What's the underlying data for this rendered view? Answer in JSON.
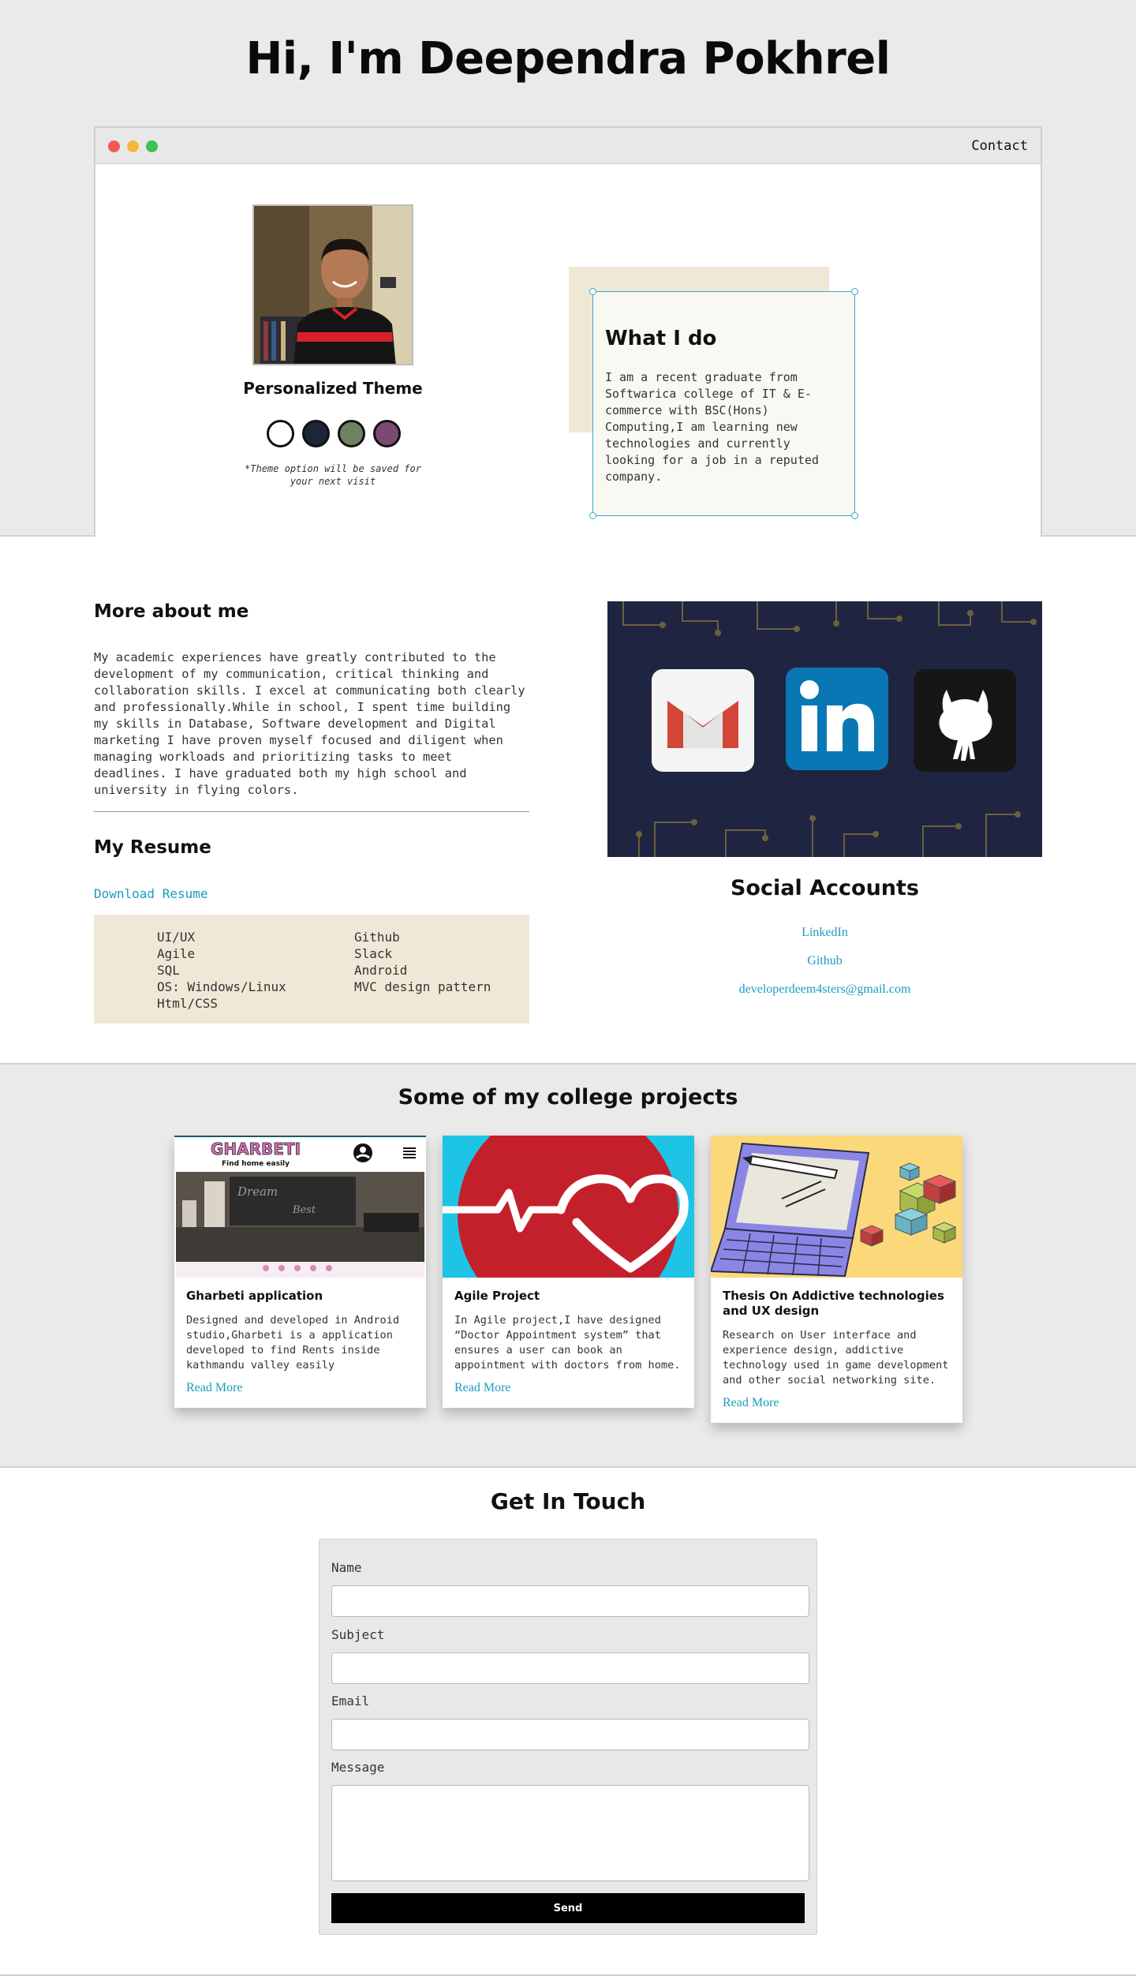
{
  "hero": {
    "title": "Hi, I'm Deependra Pokhrel",
    "contact_link": "Contact"
  },
  "theme": {
    "title": "Personalized Theme",
    "swatches": [
      "#ffffff",
      "#1c2636",
      "#6f8160",
      "#7b4a72"
    ],
    "note": "*Theme option will be saved for your next visit"
  },
  "what_i_do": {
    "title": "What I do",
    "text": "I am a recent graduate from Softwarica college of IT & E-commerce with BSC(Hons) Computing,I am learning new technologies and currently looking for a job in a reputed company."
  },
  "about": {
    "title": "More about me",
    "text": "My academic experiences have greatly contributed to the development of my communication, critical thinking and collaboration skills. I excel at communicating both clearly and professionally.While in school, I spent time building my skills in Database, Software development and Digital marketing I have proven myself focused and diligent when managing workloads and prioritizing tasks to meet deadlines. I have graduated both my high school and university in flying colors."
  },
  "resume": {
    "title": "My Resume",
    "download_label": "Download Resume",
    "skills_left": [
      "UI/UX",
      "Agile",
      "SQL",
      "OS: Windows/Linux",
      "Html/CSS"
    ],
    "skills_right": [
      "Github",
      "Slack",
      "Android",
      "MVC design pattern"
    ]
  },
  "social": {
    "icons": [
      "gmail-icon",
      "linkedin-icon",
      "github-icon"
    ],
    "title": "Social Accounts",
    "links": [
      "LinkedIn",
      "Github",
      "developerdeem4sters@gmail.com"
    ]
  },
  "projects": {
    "title": "Some of my college projects",
    "cards": [
      {
        "title": "Gharbeti application",
        "text": "Designed and developed in Android studio,Gharbeti is a application developed to find Rents inside kathmandu valley easily",
        "link": "Read More",
        "image_brand": "GHARBETI",
        "image_tagline": "Find home easily"
      },
      {
        "title": "Agile Project",
        "text": "In Agile project,I have designed “Doctor Appointment system” that ensures a user can book an appointment with doctors from home.",
        "link": "Read More"
      },
      {
        "title": "Thesis On Addictive technologies and UX design",
        "text": "Research on User interface and experience design, addictive technology used in game development and other social networking site.",
        "link": "Read More"
      }
    ]
  },
  "contact": {
    "title": "Get In Touch",
    "fields": [
      "Name",
      "Subject",
      "Email",
      "Message"
    ],
    "send_label": "Send"
  },
  "colors": {
    "accent": "#1a9cc0",
    "section_bg": "#eaeaea",
    "skills_bg": "#f0e8d6",
    "social_banner_bg": "#1f2541"
  }
}
